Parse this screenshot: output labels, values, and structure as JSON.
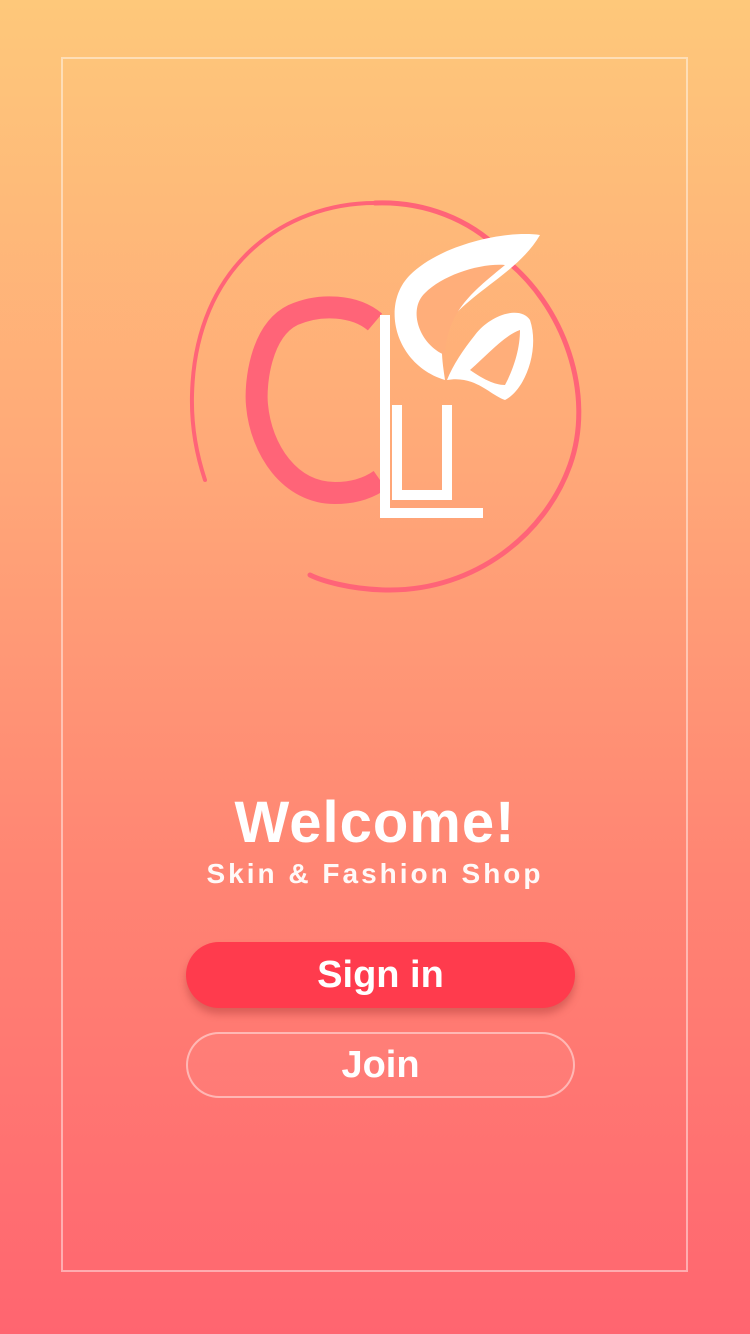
{
  "welcome": {
    "title": "Welcome!",
    "subtitle": "Skin & Fashion Shop"
  },
  "actions": {
    "sign_in_label": "Sign in",
    "join_label": "Join"
  },
  "logo": {
    "icon": "butterfly-cl-logo",
    "letters": "CL"
  },
  "colors": {
    "gradient_top": "#FEC87A",
    "gradient_bottom": "#FF6570",
    "accent": "#FF3B4D",
    "logo_pink": "#FF6478"
  }
}
